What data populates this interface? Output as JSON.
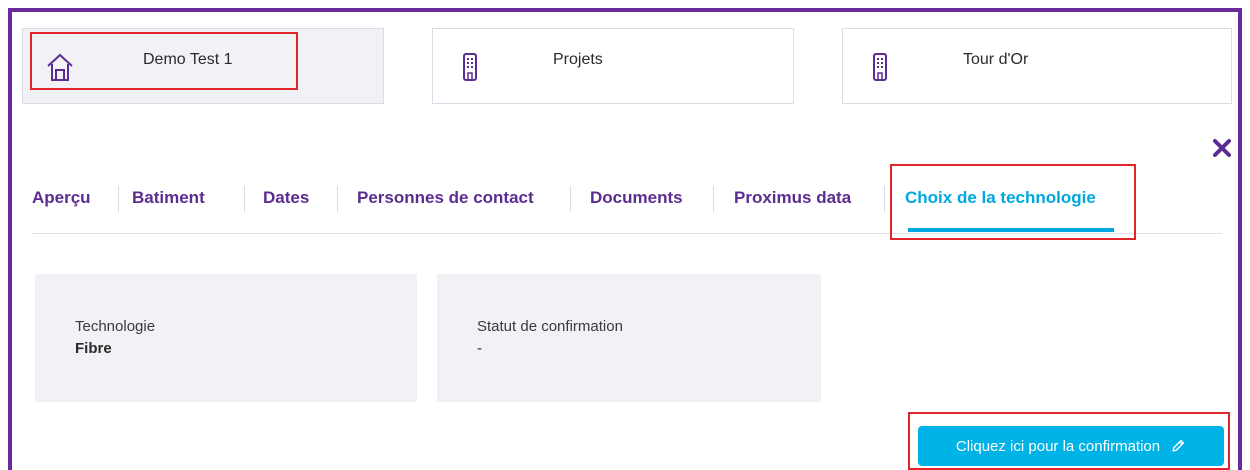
{
  "breadcrumbs": [
    {
      "label": "Demo Test 1",
      "icon": "house-icon"
    },
    {
      "label": "Projets",
      "icon": "building-icon"
    },
    {
      "label": "Tour d'Or",
      "icon": "building-icon"
    }
  ],
  "tabs": [
    {
      "label": "Aperçu"
    },
    {
      "label": "Batiment"
    },
    {
      "label": "Dates"
    },
    {
      "label": "Personnes de contact"
    },
    {
      "label": "Documents"
    },
    {
      "label": "Proximus data"
    },
    {
      "label": "Choix de la technologie",
      "selected": true
    }
  ],
  "details": {
    "technology_label": "Technologie",
    "technology_value": "Fibre",
    "status_label": "Statut de confirmation",
    "status_value": "-"
  },
  "confirm_button": {
    "label": "Cliquez ici pour la confirmation",
    "icon": "pencil-icon"
  },
  "colors": {
    "brand_purple": "#5c2d91",
    "accent_blue": "#00a8e1",
    "highlight_red": "#e0262b"
  }
}
